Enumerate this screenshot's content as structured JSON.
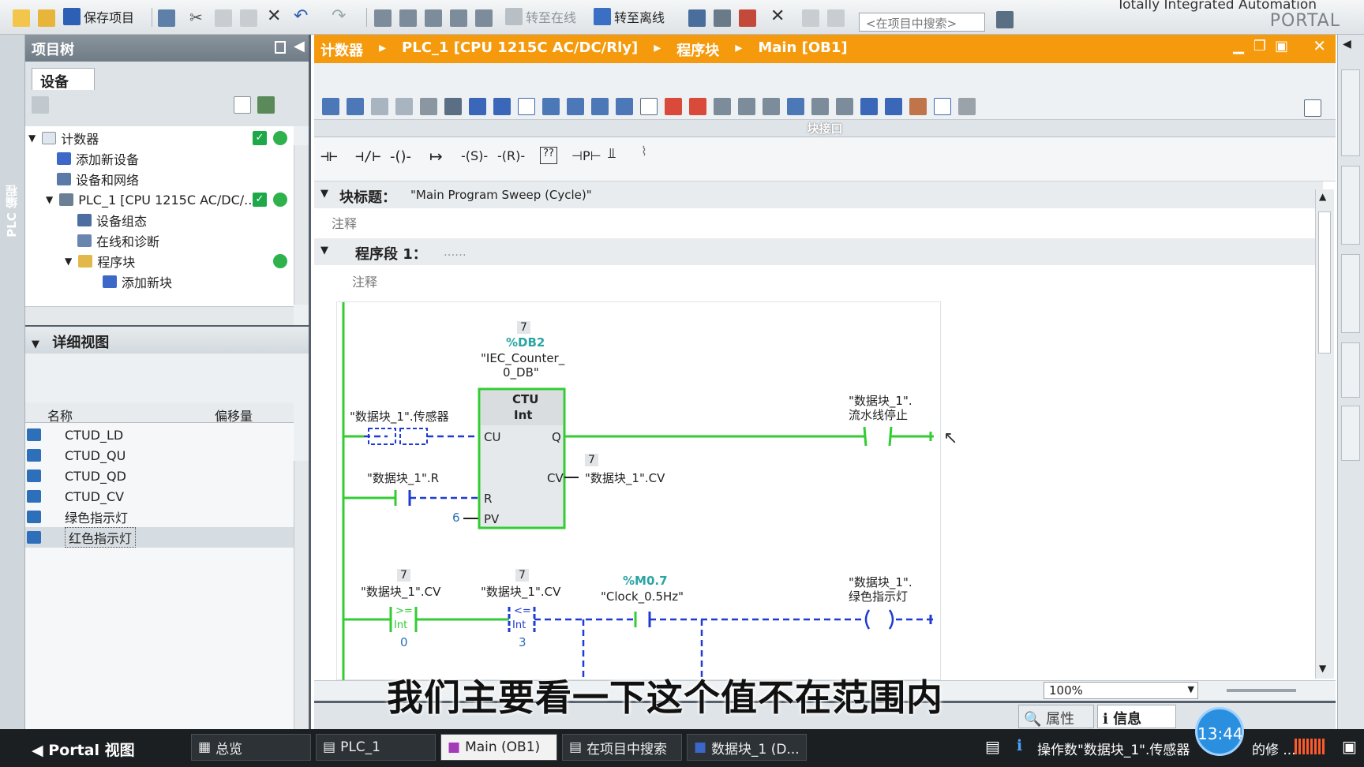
{
  "toolbar": {
    "save_label": "保存项目",
    "go_online": "转至在线",
    "go_offline": "转至离线",
    "search_placeholder": "<在项目中搜索>",
    "brand_line1": "Totally Integrated Automation",
    "brand_line2": "PORTAL"
  },
  "left_vertical_tab": "PLC 编程",
  "project_tree": {
    "title": "项目树",
    "tab": "设备",
    "items": [
      {
        "label": "计数器"
      },
      {
        "label": "添加新设备"
      },
      {
        "label": "设备和网络"
      },
      {
        "label": "PLC_1 [CPU 1215C AC/DC/..."
      },
      {
        "label": "设备组态"
      },
      {
        "label": "在线和诊断"
      },
      {
        "label": "程序块"
      },
      {
        "label": "添加新块"
      }
    ]
  },
  "detail_view": {
    "title": "详细视图",
    "columns": [
      "名称",
      "偏移量"
    ],
    "rows": [
      "CTUD_LD",
      "CTUD_QU",
      "CTUD_QD",
      "CTUD_CV",
      "绿色指示灯",
      "红色指示灯"
    ]
  },
  "editor": {
    "breadcrumb": [
      "计数器",
      "PLC_1 [CPU 1215C AC/DC/Rly]",
      "程序块",
      "Main [OB1]"
    ],
    "interface_label": "块接口",
    "block_title_label": "块标题：",
    "block_title_value": "\"Main Program Sweep (Cycle)\"",
    "comment": "注释",
    "network_label": "程序段 1：",
    "network_dots": "......",
    "zoom": "100%"
  },
  "ladder": {
    "db_num": "7",
    "db_addr": "%DB2",
    "db_name1": "\"IEC_Counter_",
    "db_name2": "0_DB\"",
    "ctu_type": "CTU",
    "ctu_dtype": "Int",
    "pin_cu": "CU",
    "pin_q": "Q",
    "pin_r": "R",
    "pin_pv": "PV",
    "pin_cv": "CV",
    "cu_tag": "\"数据块_1\".传感器",
    "r_tag": "\"数据块_1\".R",
    "pv_val": "6",
    "cv_num": "7",
    "cv_tag": "\"数据块_1\".CV",
    "coil1_tag1": "\"数据块_1\".",
    "coil1_tag2": "流水线停止",
    "cmp1_num": "7",
    "cmp1_tag": "\"数据块_1\".CV",
    "cmp1_op": ">=",
    "cmp1_type": "Int",
    "cmp1_val": "0",
    "cmp2_num": "7",
    "cmp2_tag": "\"数据块_1\".CV",
    "cmp2_op": "<=",
    "cmp2_type": "Int",
    "cmp2_val": "3",
    "clk_addr": "%M0.7",
    "clk_name": "\"Clock_0.5Hz\"",
    "coil2_tag1": "\"数据块_1\".",
    "coil2_tag2": "绿色指示灯"
  },
  "bottom_tabs": {
    "properties": "属性",
    "info": "信息"
  },
  "subtitle": "我们主要看一下这个值不在范围内",
  "taskbar": {
    "portal": "Portal 视图",
    "overview": "总览",
    "plc": "PLC_1",
    "main": "Main (OB1)",
    "search": "在项目中搜索",
    "db": "数据块_1 (D...",
    "status": "操作数\"数据块_1\".传感器",
    "status_tail": "的修 ...",
    "clock": "13:44"
  },
  "colors": {
    "accent": "#f59a0c",
    "rung": "#33cc33",
    "dashed": "#1f3bd1"
  }
}
